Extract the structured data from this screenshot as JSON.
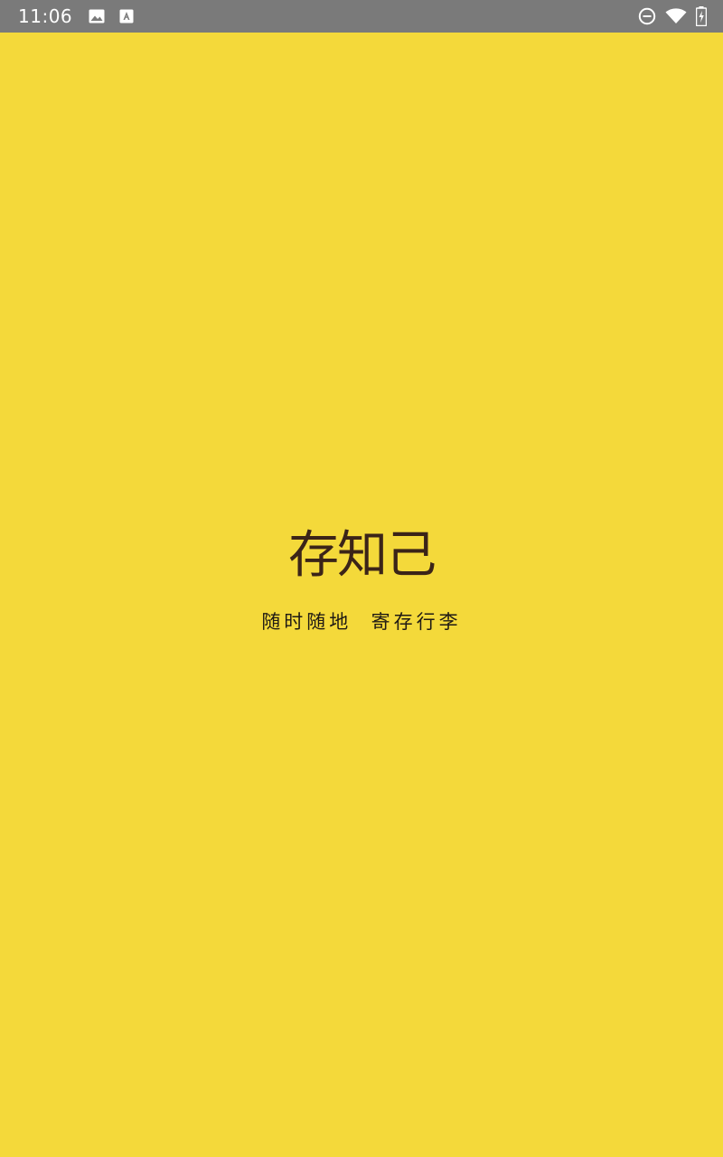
{
  "status_bar": {
    "time": "11:06",
    "left_icons": [
      "image-icon",
      "font-icon"
    ],
    "right_icons": [
      "do-not-disturb-icon",
      "wifi-icon",
      "battery-charging-icon"
    ],
    "color": "#7A7A7A"
  },
  "splash": {
    "background_color": "#F4D93A",
    "logo_text": "存知己",
    "logo_color": "#3B2418",
    "tagline": "随时随地  寄存行李"
  }
}
